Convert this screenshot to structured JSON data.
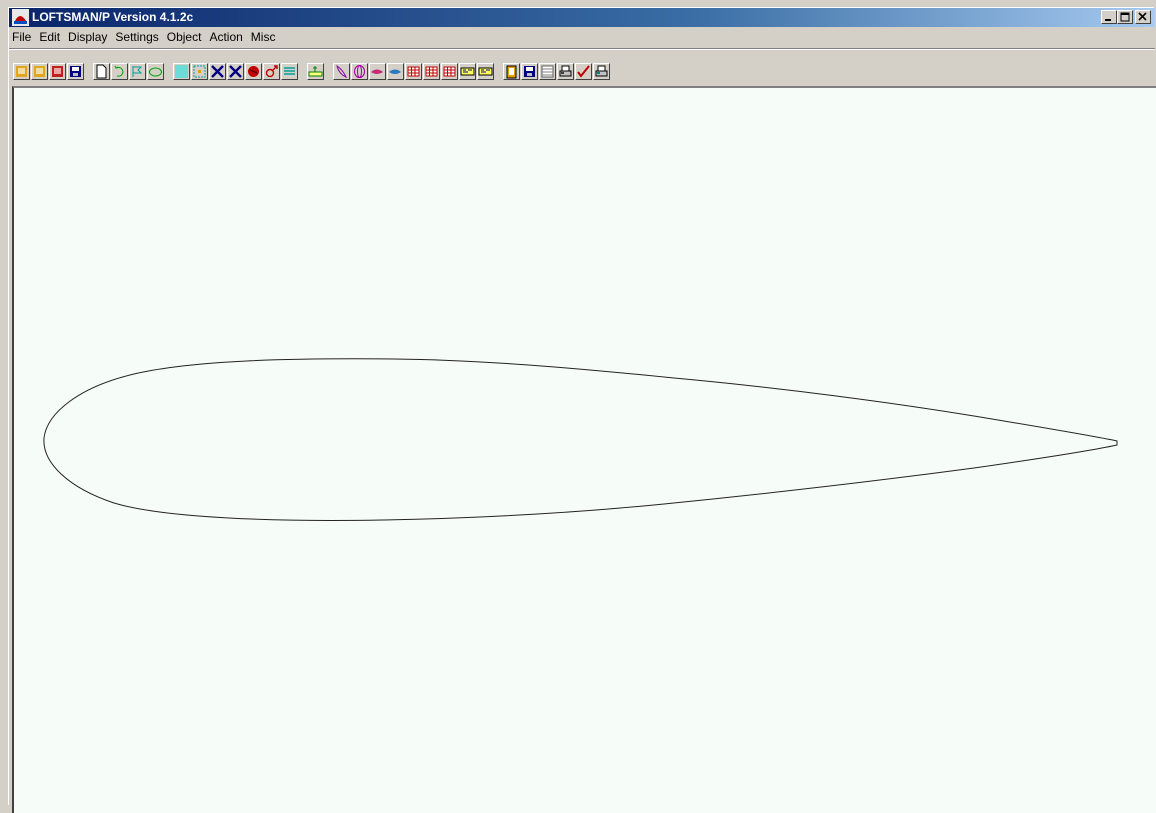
{
  "window": {
    "title": "LOFTSMAN/P Version 4.1.2c"
  },
  "menu": [
    "File",
    "Edit",
    "Display",
    "Settings",
    "Object",
    "Action",
    "Misc"
  ],
  "toolbar_buttons": [
    {
      "name": "open-file-icon",
      "color": "#e0a000"
    },
    {
      "name": "copy-icon",
      "color": "#e0a000"
    },
    {
      "name": "delete-file-icon",
      "color": "#c00000"
    },
    {
      "name": "save-icon",
      "color": "#000080"
    },
    {
      "name": "new-file-icon",
      "color": "#ffffff"
    },
    {
      "name": "rotate-icon",
      "color": "#00a000"
    },
    {
      "name": "flag-icon",
      "color": "#00a0a0"
    },
    {
      "name": "section-icon",
      "color": "#00a000"
    },
    {
      "name": "fill-icon",
      "color": "#40e0e0"
    },
    {
      "name": "fit-view-icon",
      "color": "#00a0a0"
    },
    {
      "name": "zoom-out-icon",
      "color": "#000080"
    },
    {
      "name": "zoom-in-icon",
      "color": "#000080"
    },
    {
      "name": "paint-icon",
      "color": "#c00000"
    },
    {
      "name": "gender-icon",
      "color": "#c00000"
    },
    {
      "name": "layers-icon",
      "color": "#00a0a0"
    },
    {
      "name": "ruler-icon",
      "color": "#008000"
    },
    {
      "name": "blade-icon",
      "color": "#8000a0"
    },
    {
      "name": "rings-icon",
      "color": "#a000a0"
    },
    {
      "name": "wing-icon",
      "color": "#c00060"
    },
    {
      "name": "fish-icon",
      "color": "#0060c0"
    },
    {
      "name": "grid-red-icon",
      "color": "#c00000"
    },
    {
      "name": "grid-red-2-icon",
      "color": "#c00000"
    },
    {
      "name": "grid-colored-icon",
      "color": "#c00000"
    },
    {
      "name": "bar-chart-icon",
      "color": "#000080"
    },
    {
      "name": "bar-chart-2-icon",
      "color": "#000080"
    },
    {
      "name": "clipboard-icon",
      "color": "#e0a000"
    },
    {
      "name": "disk-icon",
      "color": "#000080"
    },
    {
      "name": "table-icon",
      "color": "#808080"
    },
    {
      "name": "print-icon",
      "color": "#404040"
    },
    {
      "name": "check-icon",
      "color": "#c00000"
    },
    {
      "name": "printer-color-icon",
      "color": "#008080"
    }
  ]
}
